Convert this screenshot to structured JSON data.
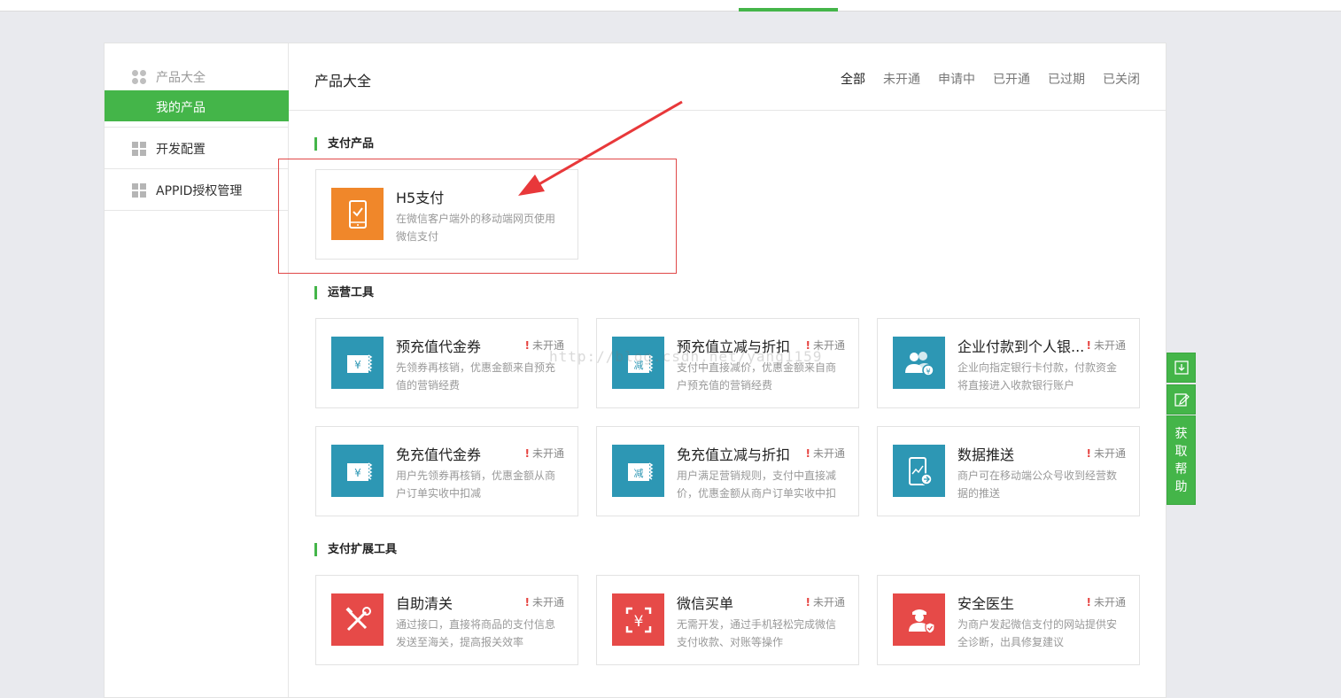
{
  "sidebar": {
    "group_title": "产品大全",
    "active_item": "我的产品",
    "items": [
      {
        "label": "开发配置"
      },
      {
        "label": "APPID授权管理"
      }
    ]
  },
  "main": {
    "title": "产品大全",
    "filters": [
      "全部",
      "未开通",
      "申请中",
      "已开通",
      "已过期",
      "已关闭"
    ],
    "active_filter": "全部",
    "sections": [
      {
        "title": "支付产品",
        "cards": [
          {
            "title": "H5支付",
            "status": "",
            "desc": "在微信客户端外的移动端网页使用微信支付",
            "icon": "phone-check-icon",
            "color": "#f0872a"
          }
        ]
      },
      {
        "title": "运营工具",
        "cards": [
          {
            "title": "预充值代金券",
            "status": "未开通",
            "desc": "先领券再核销，优惠金额来自预充值的营销经费",
            "icon": "coupon-yen-icon",
            "color": "#2d97b4"
          },
          {
            "title": "预充值立减与折扣",
            "status": "未开通",
            "desc": "支付中直接减价，优惠金额来自商户预充值的营销经费",
            "icon": "coupon-discount-icon",
            "color": "#2d97b4"
          },
          {
            "title": "企业付款到个人银...",
            "status": "未开通",
            "desc": "企业向指定银行卡付款，付款资金将直接进入收款银行账户",
            "icon": "users-transfer-icon",
            "color": "#2d97b4"
          },
          {
            "title": "免充值代金券",
            "status": "未开通",
            "desc": "用户先领券再核销，优惠金额从商户订单实收中扣减",
            "icon": "coupon-yen-icon",
            "color": "#2d97b4"
          },
          {
            "title": "免充值立减与折扣",
            "status": "未开通",
            "desc": "用户满足营销规则，支付中直接减价，优惠金额从商户订单实收中扣",
            "icon": "coupon-discount-icon",
            "color": "#2d97b4"
          },
          {
            "title": "数据推送",
            "status": "未开通",
            "desc": "商户可在移动端公众号收到经营数据的推送",
            "icon": "phone-chart-icon",
            "color": "#2d97b4"
          }
        ]
      },
      {
        "title": "支付扩展工具",
        "cards": [
          {
            "title": "自助清关",
            "status": "未开通",
            "desc": "通过接口，直接将商品的支付信息发送至海关，提高报关效率",
            "icon": "tools-icon",
            "color": "#e64a48"
          },
          {
            "title": "微信买单",
            "status": "未开通",
            "desc": "无需开发，通过手机轻松完成微信支付收款、对账等操作",
            "icon": "scan-yen-icon",
            "color": "#e64a48"
          },
          {
            "title": "安全医生",
            "status": "未开通",
            "desc": "为商户发起微信支付的网站提供安全诊断，出具修复建议",
            "icon": "doctor-shield-icon",
            "color": "#e64a48"
          }
        ]
      }
    ]
  },
  "float": {
    "help_chars": [
      "获",
      "取",
      "帮",
      "助"
    ]
  },
  "watermark": "http://blog.csdn.net/yang1159",
  "colors": {
    "brand": "#44b549",
    "annotation": "#e8383a",
    "status_alert": "#e64340"
  }
}
